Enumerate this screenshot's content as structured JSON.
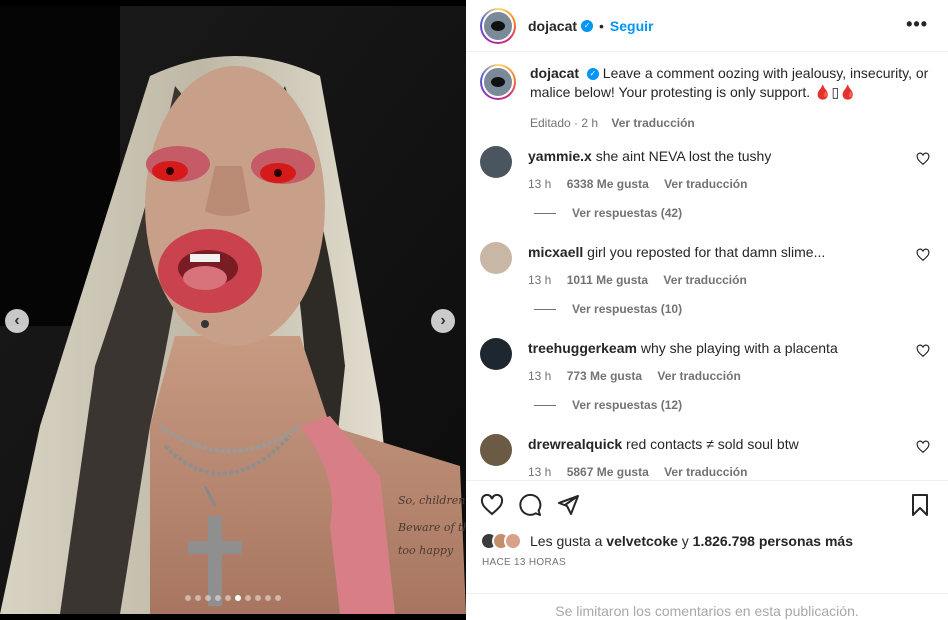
{
  "header": {
    "username": "dojacat",
    "separator": "•",
    "follow_label": "Seguir",
    "more_icon": "more-horizontal-icon"
  },
  "caption": {
    "username": "dojacat",
    "text": "Leave a comment oozing with jealousy, insecurity, or malice below! Your protesting is only support. 🩸▯🩸",
    "edited": "Editado · 2 h",
    "translate": "Ver traducción"
  },
  "comments": [
    {
      "username": "yammie.x",
      "text": "she aint NEVA lost the tushy",
      "time": "13 h",
      "likes": "6338 Me gusta",
      "translate": "Ver traducción",
      "replies": "Ver respuestas (42)",
      "avatar_color": "#4a5560"
    },
    {
      "username": "micxaell",
      "text": "girl you reposted for that damn slime...",
      "time": "13 h",
      "likes": "1011 Me gusta",
      "translate": "Ver traducción",
      "replies": "Ver respuestas (10)",
      "avatar_color": "#c9b7a6"
    },
    {
      "username": "treehuggerkeam",
      "text": "why she playing with a placenta",
      "time": "13 h",
      "likes": "773 Me gusta",
      "translate": "Ver traducción",
      "replies": "Ver respuestas (12)",
      "avatar_color": "#1e2630"
    },
    {
      "username": "drewrealquick",
      "text": "red contacts ≠ sold soul btw",
      "time": "13 h",
      "likes": "5867 Me gusta",
      "translate": "Ver traducción",
      "replies": "",
      "avatar_color": "#6b5a44"
    }
  ],
  "likes": {
    "prefix": "Les gusta a",
    "user": "velvetcoke",
    "mid": "y",
    "count": "1.826.798 personas más"
  },
  "time_ago": "HACE 13 HORAS",
  "comments_limited": "Se limitaron los comentarios en esta publicación.",
  "carousel": {
    "total": 10,
    "active": 6
  },
  "colors": {
    "accent": "#0095f6",
    "muted": "#737373",
    "text": "#262626"
  }
}
